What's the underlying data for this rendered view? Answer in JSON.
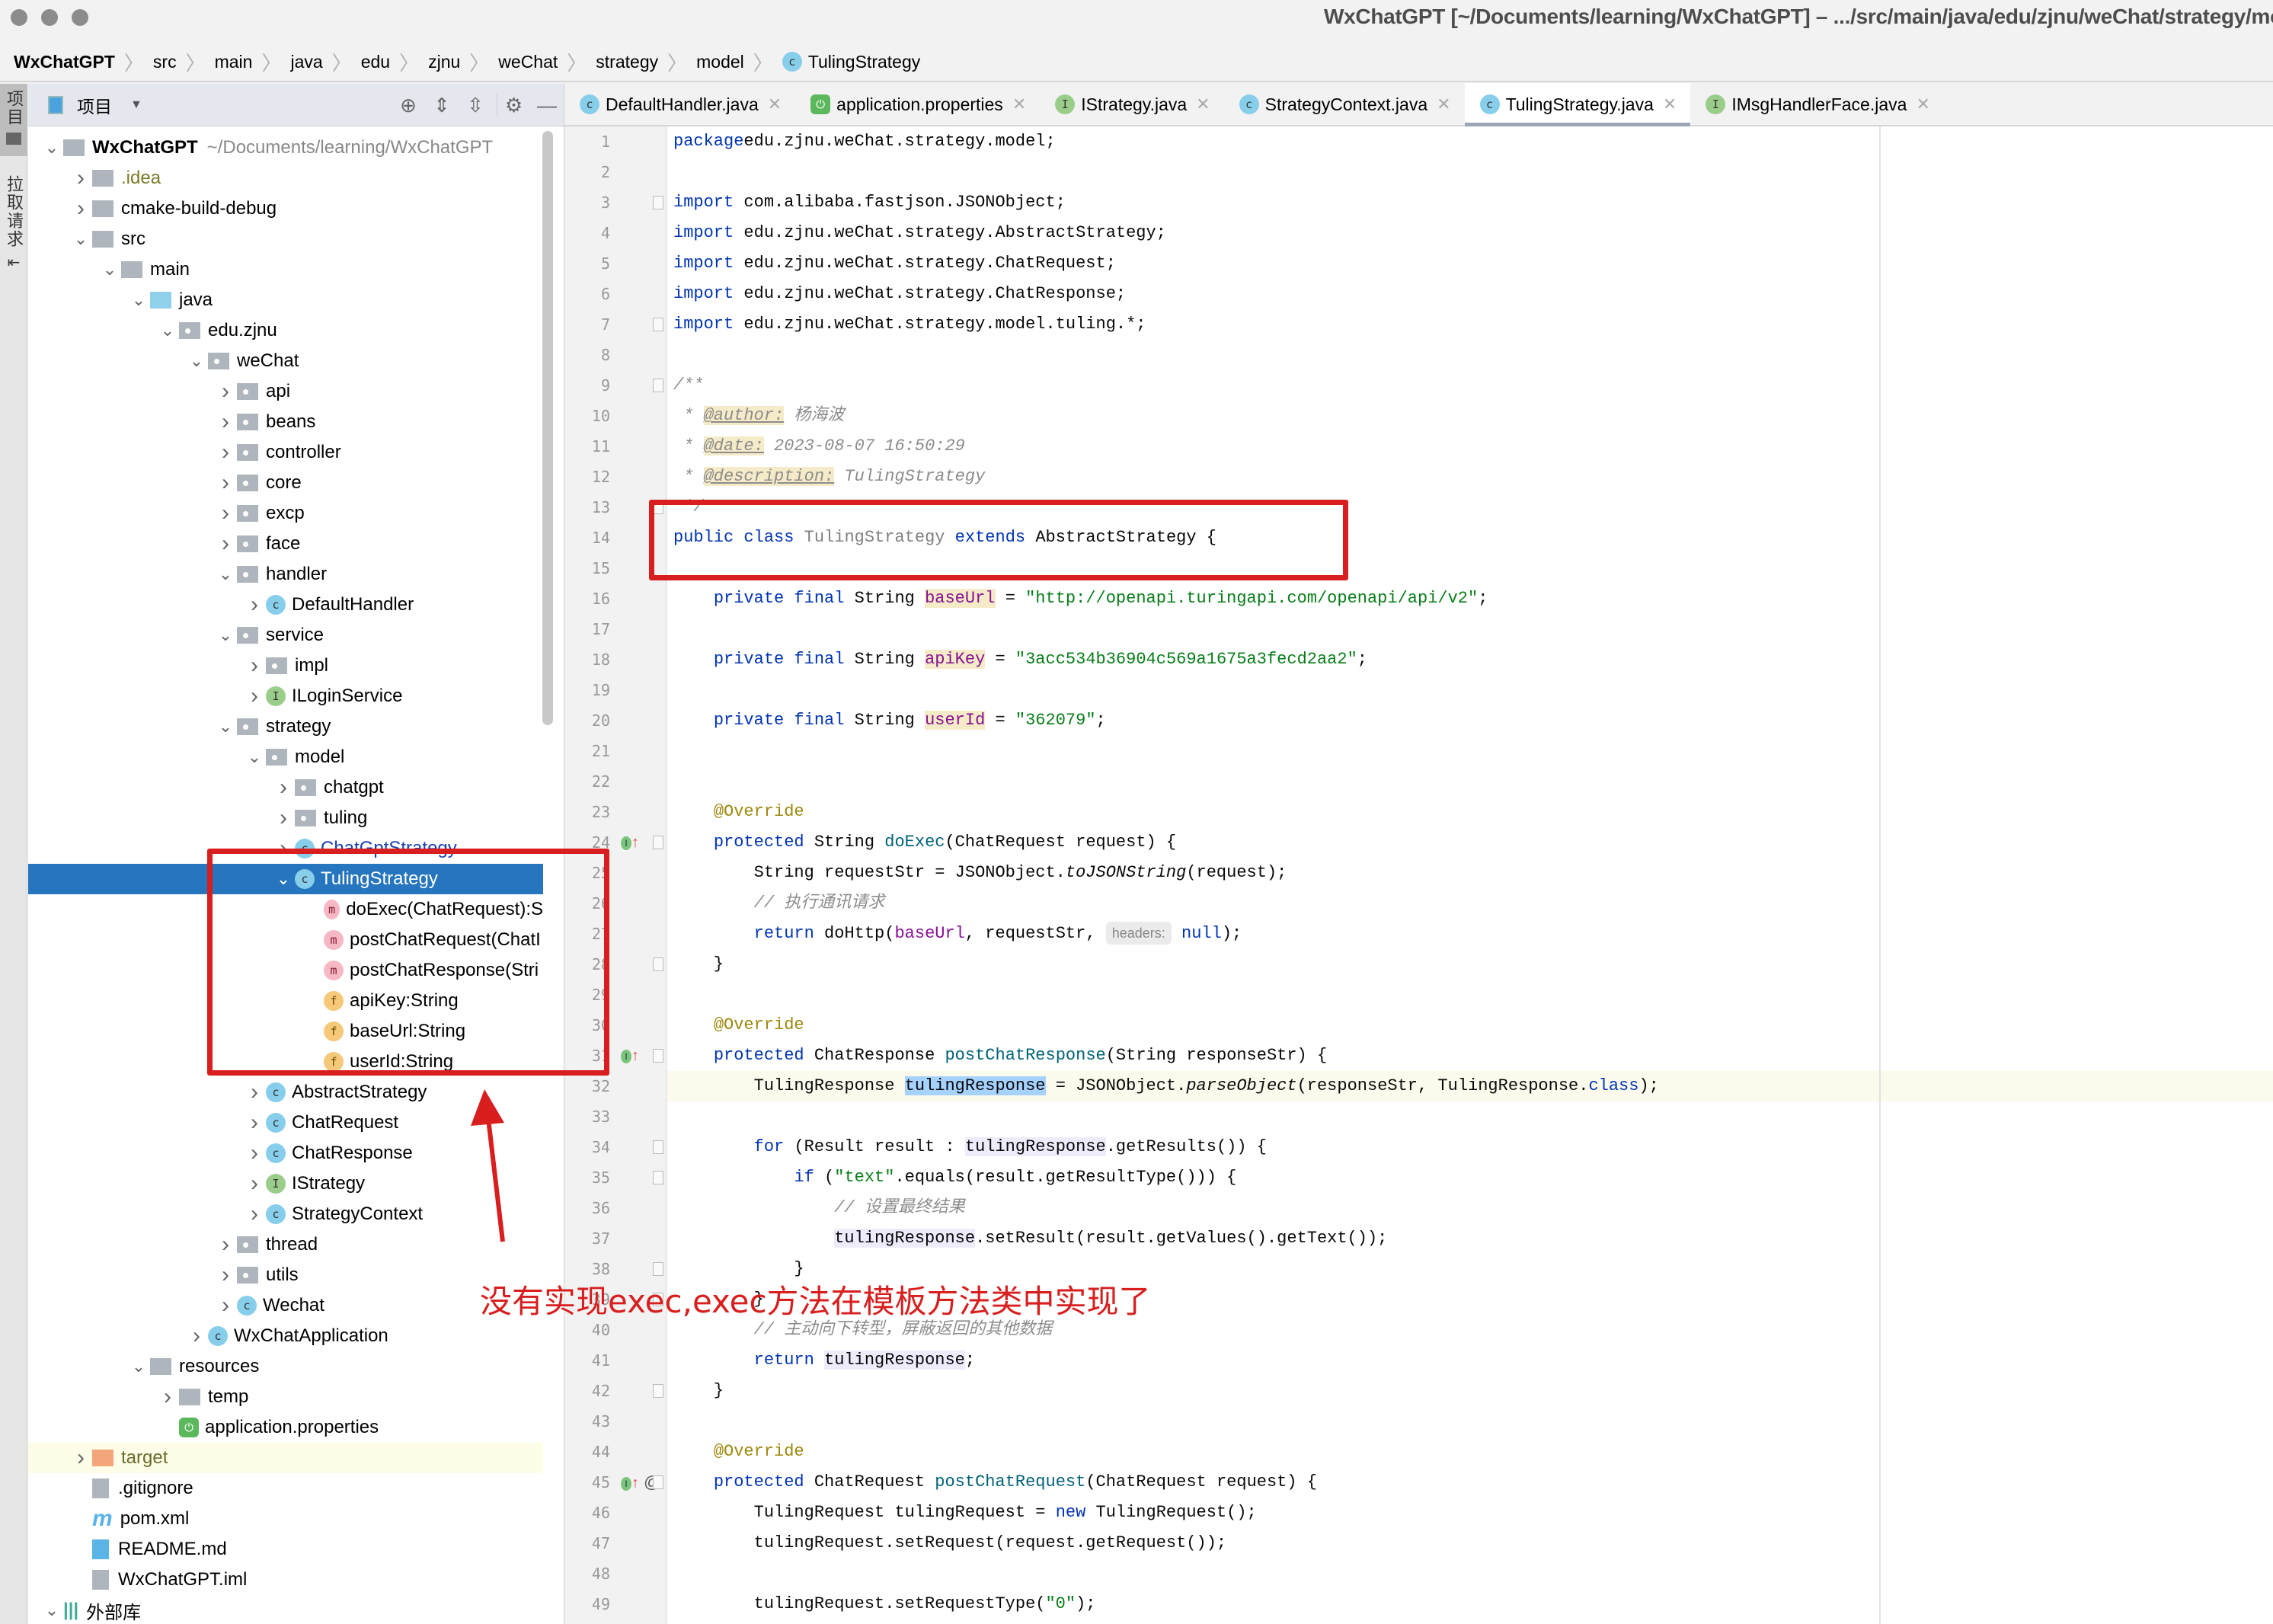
{
  "window": {
    "title": "WxChatGPT [~/Documents/learning/WxChatGPT] – .../src/main/java/edu/zjnu/weChat/strategy/model"
  },
  "breadcrumb": [
    {
      "label": "WxChatGPT"
    },
    {
      "label": "src"
    },
    {
      "label": "main"
    },
    {
      "label": "java"
    },
    {
      "label": "edu"
    },
    {
      "label": "zjnu"
    },
    {
      "label": "weChat"
    },
    {
      "label": "strategy"
    },
    {
      "label": "model"
    },
    {
      "label": "TulingStrategy",
      "icon": "class-icon"
    }
  ],
  "left_strip": {
    "project_tab": "项目",
    "pull_request_tab": "拉取请求"
  },
  "project_panel": {
    "title": "项目",
    "tools": [
      "locate-icon",
      "expand-all-icon",
      "collapse-all-icon",
      "gear-icon",
      "minimize-icon"
    ],
    "tree": [
      {
        "label": "WxChatGPT",
        "sub": "~/Documents/learning/WxChatGPT",
        "depth": 0,
        "arrow": "down",
        "icon": "module",
        "bold": true
      },
      {
        "label": ".idea",
        "depth": 1,
        "arrow": "right",
        "icon": "folder",
        "color": "#7a7a2a"
      },
      {
        "label": "cmake-build-debug",
        "depth": 1,
        "arrow": "right",
        "icon": "folder"
      },
      {
        "label": "src",
        "depth": 1,
        "arrow": "down",
        "icon": "folder"
      },
      {
        "label": "main",
        "depth": 2,
        "arrow": "down",
        "icon": "folder"
      },
      {
        "label": "java",
        "depth": 3,
        "arrow": "down",
        "icon": "folder-blue"
      },
      {
        "label": "edu.zjnu",
        "depth": 4,
        "arrow": "down",
        "icon": "package"
      },
      {
        "label": "weChat",
        "depth": 5,
        "arrow": "down",
        "icon": "package"
      },
      {
        "label": "api",
        "depth": 6,
        "arrow": "right",
        "icon": "package"
      },
      {
        "label": "beans",
        "depth": 6,
        "arrow": "right",
        "icon": "package"
      },
      {
        "label": "controller",
        "depth": 6,
        "arrow": "right",
        "icon": "package"
      },
      {
        "label": "core",
        "depth": 6,
        "arrow": "right",
        "icon": "package"
      },
      {
        "label": "excp",
        "depth": 6,
        "arrow": "right",
        "icon": "package"
      },
      {
        "label": "face",
        "depth": 6,
        "arrow": "right",
        "icon": "package"
      },
      {
        "label": "handler",
        "depth": 6,
        "arrow": "down",
        "icon": "package"
      },
      {
        "label": "DefaultHandler",
        "depth": 7,
        "arrow": "right",
        "icon": "class"
      },
      {
        "label": "service",
        "depth": 6,
        "arrow": "down",
        "icon": "package"
      },
      {
        "label": "impl",
        "depth": 7,
        "arrow": "right",
        "icon": "package"
      },
      {
        "label": "ILoginService",
        "depth": 7,
        "arrow": "right",
        "icon": "interface"
      },
      {
        "label": "strategy",
        "depth": 6,
        "arrow": "down",
        "icon": "package"
      },
      {
        "label": "model",
        "depth": 7,
        "arrow": "down",
        "icon": "package"
      },
      {
        "label": "chatgpt",
        "depth": 8,
        "arrow": "right",
        "icon": "package"
      },
      {
        "label": "tuling",
        "depth": 8,
        "arrow": "right",
        "icon": "package"
      },
      {
        "label": "ChatGptStrategy",
        "depth": 8,
        "arrow": "right",
        "icon": "class",
        "color": "#1a3fb0"
      },
      {
        "label": "TulingStrategy",
        "depth": 8,
        "arrow": "down",
        "icon": "class",
        "selected": true
      },
      {
        "label": "doExec(ChatRequest):S",
        "depth": 9,
        "arrow": "",
        "icon": "method"
      },
      {
        "label": "postChatRequest(ChatI",
        "depth": 9,
        "arrow": "",
        "icon": "method"
      },
      {
        "label": "postChatResponse(Stri",
        "depth": 9,
        "arrow": "",
        "icon": "method"
      },
      {
        "label": "apiKey:String",
        "depth": 9,
        "arrow": "",
        "icon": "field"
      },
      {
        "label": "baseUrl:String",
        "depth": 9,
        "arrow": "",
        "icon": "field"
      },
      {
        "label": "userId:String",
        "depth": 9,
        "arrow": "",
        "icon": "field"
      },
      {
        "label": "AbstractStrategy",
        "depth": 7,
        "arrow": "right",
        "icon": "abstract-class"
      },
      {
        "label": "ChatRequest",
        "depth": 7,
        "arrow": "right",
        "icon": "class"
      },
      {
        "label": "ChatResponse",
        "depth": 7,
        "arrow": "right",
        "icon": "class"
      },
      {
        "label": "IStrategy",
        "depth": 7,
        "arrow": "right",
        "icon": "interface"
      },
      {
        "label": "StrategyContext",
        "depth": 7,
        "arrow": "right",
        "icon": "class"
      },
      {
        "label": "thread",
        "depth": 6,
        "arrow": "right",
        "icon": "package"
      },
      {
        "label": "utils",
        "depth": 6,
        "arrow": "right",
        "icon": "package"
      },
      {
        "label": "Wechat",
        "depth": 6,
        "arrow": "right",
        "icon": "class"
      },
      {
        "label": "WxChatApplication",
        "depth": 5,
        "arrow": "right",
        "icon": "spring-class"
      },
      {
        "label": "resources",
        "depth": 3,
        "arrow": "down",
        "icon": "folder"
      },
      {
        "label": "temp",
        "depth": 4,
        "arrow": "right",
        "icon": "folder"
      },
      {
        "label": "application.properties",
        "depth": 4,
        "arrow": "",
        "icon": "spring"
      },
      {
        "label": "target",
        "depth": 1,
        "arrow": "right",
        "icon": "folder-orange",
        "color": "#6a6a2a",
        "highlight": true
      },
      {
        "label": ".gitignore",
        "depth": 1,
        "arrow": "",
        "icon": "file"
      },
      {
        "label": "pom.xml",
        "depth": 1,
        "arrow": "",
        "icon": "maven"
      },
      {
        "label": "README.md",
        "depth": 1,
        "arrow": "",
        "icon": "markdown"
      },
      {
        "label": "WxChatGPT.iml",
        "depth": 1,
        "arrow": "",
        "icon": "file"
      },
      {
        "label": "外部库",
        "depth": 0,
        "arrow": "down",
        "icon": "library"
      }
    ]
  },
  "tabs": [
    {
      "label": "DefaultHandler.java",
      "icon": "class"
    },
    {
      "label": "application.properties",
      "icon": "spring"
    },
    {
      "label": "IStrategy.java",
      "icon": "interface"
    },
    {
      "label": "StrategyContext.java",
      "icon": "class"
    },
    {
      "label": "TulingStrategy.java",
      "icon": "class",
      "active": true
    },
    {
      "label": "IMsgHandlerFace.java",
      "icon": "interface"
    }
  ],
  "editor": {
    "current_line": 32,
    "lines": [
      {
        "n": 1,
        "tokens": [
          [
            "kw",
            "package"
          ],
          [
            "",
            "edu.zjnu.weChat.strategy.model;"
          ]
        ]
      },
      {
        "n": 2,
        "tokens": []
      },
      {
        "n": 3,
        "tokens": [
          [
            "kw",
            "import"
          ],
          [
            "",
            " com.alibaba.fastjson.JSONObject;"
          ]
        ]
      },
      {
        "n": 4,
        "tokens": [
          [
            "kw",
            "import"
          ],
          [
            "",
            " edu.zjnu.weChat.strategy.AbstractStrategy;"
          ]
        ]
      },
      {
        "n": 5,
        "tokens": [
          [
            "kw",
            "import"
          ],
          [
            "",
            " edu.zjnu.weChat.strategy.ChatRequest;"
          ]
        ]
      },
      {
        "n": 6,
        "tokens": [
          [
            "kw",
            "import"
          ],
          [
            "",
            " edu.zjnu.weChat.strategy.ChatResponse;"
          ]
        ]
      },
      {
        "n": 7,
        "tokens": [
          [
            "kw",
            "import"
          ],
          [
            "",
            " edu.zjnu.weChat.strategy.model.tuling.*;"
          ]
        ]
      },
      {
        "n": 8,
        "tokens": []
      },
      {
        "n": 9,
        "tokens": [
          [
            "com",
            "/**"
          ]
        ]
      },
      {
        "n": 10,
        "tokens": [
          [
            "com",
            " * "
          ],
          [
            "tag",
            "@author:"
          ],
          [
            "com",
            " 杨海波"
          ]
        ]
      },
      {
        "n": 11,
        "tokens": [
          [
            "com",
            " * "
          ],
          [
            "tag",
            "@date:"
          ],
          [
            "com",
            " 2023-08-07 16:50:29"
          ]
        ]
      },
      {
        "n": 12,
        "tokens": [
          [
            "com",
            " * "
          ],
          [
            "tag",
            "@description:"
          ],
          [
            "com",
            " TulingStrategy"
          ]
        ]
      },
      {
        "n": 13,
        "tokens": [
          [
            "com",
            " */"
          ]
        ]
      },
      {
        "n": 14,
        "tokens": [
          [
            "kw",
            "public class "
          ],
          [
            "grey",
            "TulingStrategy"
          ],
          [
            "kw",
            " extends "
          ],
          [
            "",
            "AbstractStrategy {"
          ]
        ]
      },
      {
        "n": 15,
        "tokens": []
      },
      {
        "n": 16,
        "tokens": [
          [
            "",
            "    "
          ],
          [
            "kw",
            "private final "
          ],
          [
            "",
            "String "
          ],
          [
            "fld",
            "baseUrl"
          ],
          [
            "",
            " = "
          ],
          [
            "str",
            "\"http://openapi.turingapi.com/openapi/api/v2\""
          ],
          [
            "",
            ";"
          ]
        ]
      },
      {
        "n": 17,
        "tokens": []
      },
      {
        "n": 18,
        "tokens": [
          [
            "",
            "    "
          ],
          [
            "kw",
            "private final "
          ],
          [
            "",
            "String "
          ],
          [
            "fld",
            "apiKey"
          ],
          [
            "",
            " = "
          ],
          [
            "str",
            "\"3acc534b36904c569a1675a3fecd2aa2\""
          ],
          [
            "",
            ";"
          ]
        ]
      },
      {
        "n": 19,
        "tokens": []
      },
      {
        "n": 20,
        "tokens": [
          [
            "",
            "    "
          ],
          [
            "kw",
            "private final "
          ],
          [
            "",
            "String "
          ],
          [
            "fld",
            "userId"
          ],
          [
            "",
            " = "
          ],
          [
            "str",
            "\"362079\""
          ],
          [
            "",
            ";"
          ]
        ]
      },
      {
        "n": 21,
        "tokens": []
      },
      {
        "n": 22,
        "tokens": []
      },
      {
        "n": 23,
        "tokens": [
          [
            "",
            "    "
          ],
          [
            "ann",
            "@Override"
          ]
        ]
      },
      {
        "n": 24,
        "tokens": [
          [
            "",
            "    "
          ],
          [
            "kw",
            "protected "
          ],
          [
            "",
            "String "
          ],
          [
            "fn",
            "doExec"
          ],
          [
            "",
            "(ChatRequest request) {"
          ]
        ]
      },
      {
        "n": 25,
        "tokens": [
          [
            "",
            "        String requestStr = JSONObject."
          ],
          [
            "it",
            "toJSONString"
          ],
          [
            "",
            "(request);"
          ]
        ]
      },
      {
        "n": 26,
        "tokens": [
          [
            "",
            "        "
          ],
          [
            "com",
            "// 执行通讯请求"
          ]
        ]
      },
      {
        "n": 27,
        "tokens": [
          [
            "",
            "        "
          ],
          [
            "kw",
            "return "
          ],
          [
            "",
            "doHttp("
          ],
          [
            "fldp",
            "baseUrl"
          ],
          [
            "",
            ", requestStr, "
          ],
          [
            "hint",
            "headers:"
          ],
          [
            "kw",
            " null"
          ],
          [
            "",
            ");"
          ]
        ]
      },
      {
        "n": 28,
        "tokens": [
          [
            "",
            "    }"
          ]
        ]
      },
      {
        "n": 29,
        "tokens": []
      },
      {
        "n": 30,
        "tokens": [
          [
            "",
            "    "
          ],
          [
            "ann",
            "@Override"
          ]
        ]
      },
      {
        "n": 31,
        "tokens": [
          [
            "",
            "    "
          ],
          [
            "kw",
            "protected "
          ],
          [
            "",
            "ChatResponse "
          ],
          [
            "fn",
            "postChatResponse"
          ],
          [
            "",
            "(String responseStr) {"
          ]
        ]
      },
      {
        "n": 32,
        "tokens": [
          [
            "",
            "        TulingResponse "
          ],
          [
            "sel",
            "tulingResponse"
          ],
          [
            "",
            " = JSONObject."
          ],
          [
            "it",
            "parseObject"
          ],
          [
            "",
            "(responseStr, TulingResponse."
          ],
          [
            "kw",
            "class"
          ],
          [
            "",
            ");"
          ]
        ]
      },
      {
        "n": 33,
        "tokens": []
      },
      {
        "n": 34,
        "tokens": [
          [
            "",
            "        "
          ],
          [
            "kw",
            "for "
          ],
          [
            "",
            "(Result result : "
          ],
          [
            "uhl",
            "tulingResponse"
          ],
          [
            "",
            ".getResults()) {"
          ]
        ]
      },
      {
        "n": 35,
        "tokens": [
          [
            "",
            "            "
          ],
          [
            "kw",
            "if "
          ],
          [
            "",
            "("
          ],
          [
            "str",
            "\"text\""
          ],
          [
            "",
            ".equals(result.getResultType())) {"
          ]
        ]
      },
      {
        "n": 36,
        "tokens": [
          [
            "",
            "                "
          ],
          [
            "com",
            "// 设置最终结果"
          ]
        ]
      },
      {
        "n": 37,
        "tokens": [
          [
            "",
            "                "
          ],
          [
            "uhl",
            "tulingResponse"
          ],
          [
            "",
            ".setResult(result.getValues().getText());"
          ]
        ]
      },
      {
        "n": 38,
        "tokens": [
          [
            "",
            "            }"
          ]
        ]
      },
      {
        "n": 39,
        "tokens": [
          [
            "",
            "        }"
          ]
        ]
      },
      {
        "n": 40,
        "tokens": [
          [
            "",
            "        "
          ],
          [
            "com",
            "// 主动向下转型，屏蔽返回的其他数据"
          ]
        ]
      },
      {
        "n": 41,
        "tokens": [
          [
            "",
            "        "
          ],
          [
            "kw",
            "return "
          ],
          [
            "uhl",
            "tulingResponse"
          ],
          [
            "",
            ";"
          ]
        ]
      },
      {
        "n": 42,
        "tokens": [
          [
            "",
            "    }"
          ]
        ]
      },
      {
        "n": 43,
        "tokens": []
      },
      {
        "n": 44,
        "tokens": [
          [
            "",
            "    "
          ],
          [
            "ann",
            "@Override"
          ]
        ]
      },
      {
        "n": 45,
        "tokens": [
          [
            "",
            "    "
          ],
          [
            "kw",
            "protected "
          ],
          [
            "",
            "ChatRequest "
          ],
          [
            "fn",
            "postChatRequest"
          ],
          [
            "",
            "(ChatRequest request) {"
          ]
        ]
      },
      {
        "n": 46,
        "tokens": [
          [
            "",
            "        TulingRequest tulingRequest = "
          ],
          [
            "kw",
            "new "
          ],
          [
            "",
            "TulingRequest();"
          ]
        ]
      },
      {
        "n": 47,
        "tokens": [
          [
            "",
            "        tulingRequest.setRequest(request.getRequest());"
          ]
        ]
      },
      {
        "n": 48,
        "tokens": []
      },
      {
        "n": 49,
        "tokens": [
          [
            "",
            "        tulingRequest.setRequestType("
          ],
          [
            "str",
            "\"0\""
          ],
          [
            "",
            ");"
          ]
        ]
      }
    ],
    "gutter_markers": [
      {
        "line": 24,
        "marks": [
          "implements-icon"
        ]
      },
      {
        "line": 31,
        "marks": [
          "implements-icon"
        ]
      },
      {
        "line": 45,
        "marks": [
          "implements-icon",
          "at-icon"
        ]
      }
    ]
  },
  "annotation": {
    "text": "没有实现exec,exec方法在模板方法类中实现了",
    "color": "#d81e1e"
  }
}
